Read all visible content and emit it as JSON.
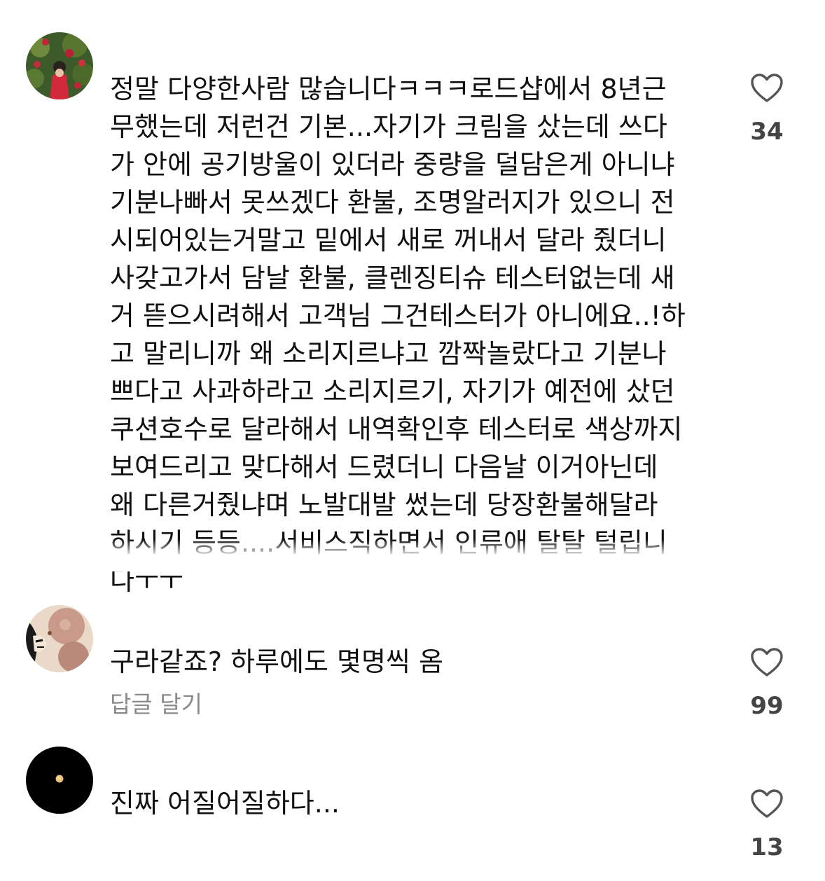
{
  "comments": [
    {
      "lines": [
        "정말 다양한사람 많습니다ㅋㅋㅋ로드샵에서 8년근",
        "무했는데 저런건 기본...자기가 크림을 샀는데 쓰다",
        "가 안에 공기방울이 있더라 중량을 덜담은게 아니냐",
        "기분나빠서 못쓰겠다 환불, 조명알러지가 있으니 전",
        "시되어있는거말고 밑에서 새로 꺼내서 달라 줬더니",
        "사갖고가서 담날 환불, 클렌징티슈 테스터없는데 새",
        "거 뜯으시려해서 고객님 그건테스터가 아니에요..!하",
        "고 말리니까 왜 소리지르냐고 깜짝놀랐다고 기분나",
        "쁘다고 사과하라고 소리지르기, 자기가 예전에 샀던",
        "쿠션호수로 달라해서 내역확인후 테스터로 색상까지",
        "보여드리고 맞다해서 드렸더니 다음날 이거아닌데",
        "왜 다른거줬냐며 노발대발 썼는데 당장환불해달라",
        "하시기 등등....서비스직하면서 인류애 탈탈 털립니",
        "다ㅜㅜ"
      ],
      "likes": "34",
      "icon": "heart-outline-icon"
    },
    {
      "lines": [
        "구라같죠? 하루에도 몇명씩 옴"
      ],
      "reply_label": "답글 달기",
      "likes": "99",
      "icon": "heart-outline-icon"
    },
    {
      "lines": [
        "진짜 어질어질하다..."
      ],
      "likes": "13",
      "icon": "heart-outline-icon"
    }
  ],
  "colors": {
    "text": "#111111",
    "secondary": "#8a8a8a",
    "count": "#444444",
    "heart_stroke": "#555555"
  }
}
